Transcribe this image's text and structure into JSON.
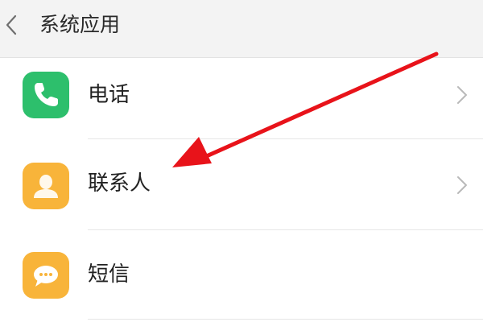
{
  "header": {
    "title": "系统应用",
    "back_icon": "chevron-left-icon"
  },
  "apps": [
    {
      "label": "电话",
      "icon": "phone-icon",
      "color": "#2dbf6c"
    },
    {
      "label": "联系人",
      "icon": "contact-person-icon",
      "color": "#f8b43a"
    },
    {
      "label": "短信",
      "icon": "message-bubble-icon",
      "color": "#f8b43a"
    }
  ],
  "annotation": {
    "icon": "red-arrow-icon",
    "color": "#e8131a"
  }
}
